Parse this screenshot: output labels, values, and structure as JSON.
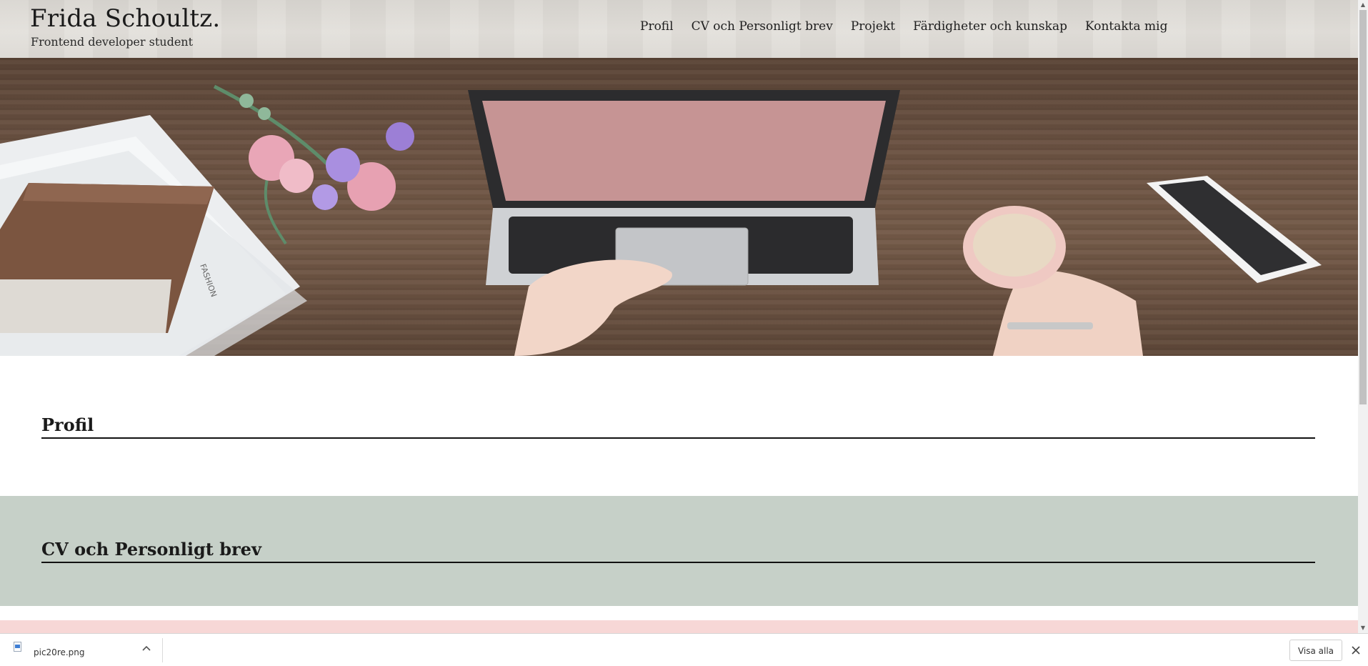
{
  "header": {
    "title": "Frida Schoultz.",
    "subtitle": "Frontend developer student"
  },
  "nav": {
    "items": [
      "Profil",
      "CV och Personligt brev",
      "Projekt",
      "Färdigheter och kunskap",
      "Kontakta mig"
    ]
  },
  "sections": {
    "profile_title": "Profil",
    "cv_title": "CV och Personligt brev"
  },
  "download_bar": {
    "file_name": "pic20re.png",
    "show_all_label": "Visa alla"
  },
  "icons": {
    "file": "image-file-icon",
    "expand": "chevron-up-icon",
    "close": "close-icon"
  },
  "colors": {
    "cv_band": "#c6d0c8",
    "projects_band": "#f7d7d6",
    "header_bg": "#e0ddd8"
  }
}
